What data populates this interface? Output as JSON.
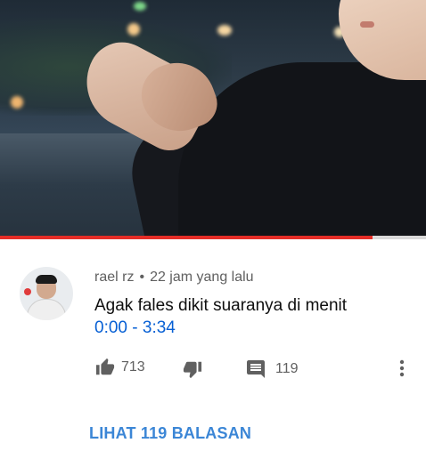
{
  "video": {
    "progress_fraction": 0.875
  },
  "comment": {
    "author": "rael rz",
    "separator": "•",
    "time_ago": "22 jam yang lalu",
    "text": "Agak fales dikit suaranya di menit",
    "timestamp_start": "0:00",
    "timestamp_sep": " - ",
    "timestamp_end": "3:34"
  },
  "actions": {
    "like_icon": "thumbs-up-icon",
    "like_count": "713",
    "dislike_icon": "thumbs-down-icon",
    "reply_icon": "comment-icon",
    "reply_count": "119",
    "more_icon": "more-vertical-icon"
  },
  "replies": {
    "label": "LIHAT 119 BALASAN"
  },
  "colors": {
    "accent_link": "#3b86d6",
    "timestamp_link": "#065fd4",
    "progress": "#e52d27",
    "meta_text": "#606060"
  }
}
